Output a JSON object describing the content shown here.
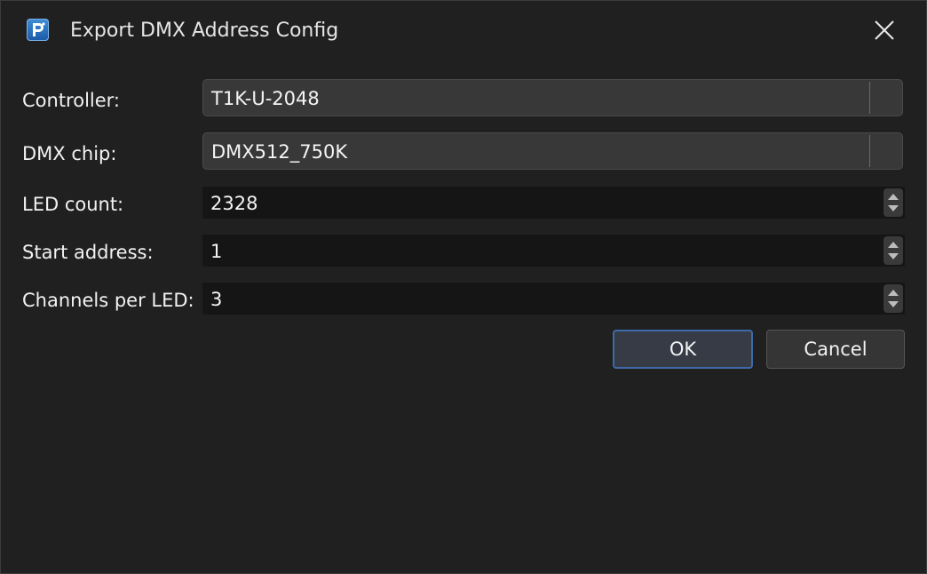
{
  "window": {
    "title": "Export DMX Address Config",
    "app_icon": "app-logo-icon",
    "close_icon": "close-icon"
  },
  "form": {
    "controller": {
      "label": "Controller:",
      "value": "T1K-U-2048"
    },
    "dmx_chip": {
      "label": "DMX chip:",
      "value": "DMX512_750K"
    },
    "led_count": {
      "label": "LED count:",
      "value": "2328"
    },
    "start_address": {
      "label": "Start address:",
      "value": "1"
    },
    "channels_per_led": {
      "label": "Channels per LED:",
      "value": "3"
    }
  },
  "buttons": {
    "ok": "OK",
    "cancel": "Cancel"
  },
  "colors": {
    "background": "#202020",
    "combo_bg": "#383838",
    "spin_bg": "#151515",
    "ok_border": "#3f6aa8",
    "app_icon_blue": "#2e73c4"
  }
}
